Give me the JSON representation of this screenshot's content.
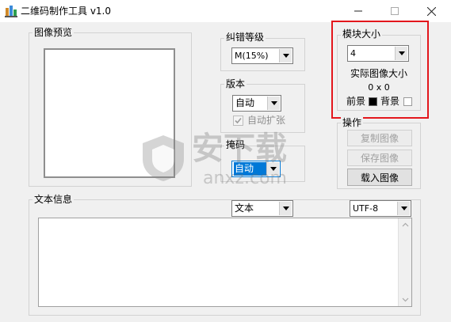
{
  "window": {
    "title": "二维码制作工具 v1.0",
    "controls": {
      "minimize": "—",
      "maximize": "☐",
      "close": "✕"
    }
  },
  "preview": {
    "group_label": "图像预览"
  },
  "ec_level": {
    "group_label": "纠错等级",
    "selected": "M(15%)"
  },
  "version": {
    "group_label": "版本",
    "selected": "自动",
    "auto_expand_label": "自动扩张",
    "auto_expand_checked": true
  },
  "mask": {
    "group_label": "掩码",
    "selected": "自动"
  },
  "module": {
    "group_label": "模块大小",
    "selected": "4",
    "actual_size_label": "实际图像大小",
    "actual_size_value": "0 x 0",
    "fg_label": "前景",
    "bg_label": "背景",
    "fg_color": "#000000",
    "bg_color": "#ffffff",
    "highlight_color": "#e3161c"
  },
  "operations": {
    "group_label": "操作",
    "copy_image": "复制图像",
    "save_image": "保存图像",
    "load_image": "载入图像"
  },
  "text_info": {
    "group_label": "文本信息",
    "type_selected": "文本",
    "encoding_selected": "UTF-8",
    "content": ""
  },
  "watermark": {
    "brand": "安下载",
    "domain": "anxz.com"
  }
}
